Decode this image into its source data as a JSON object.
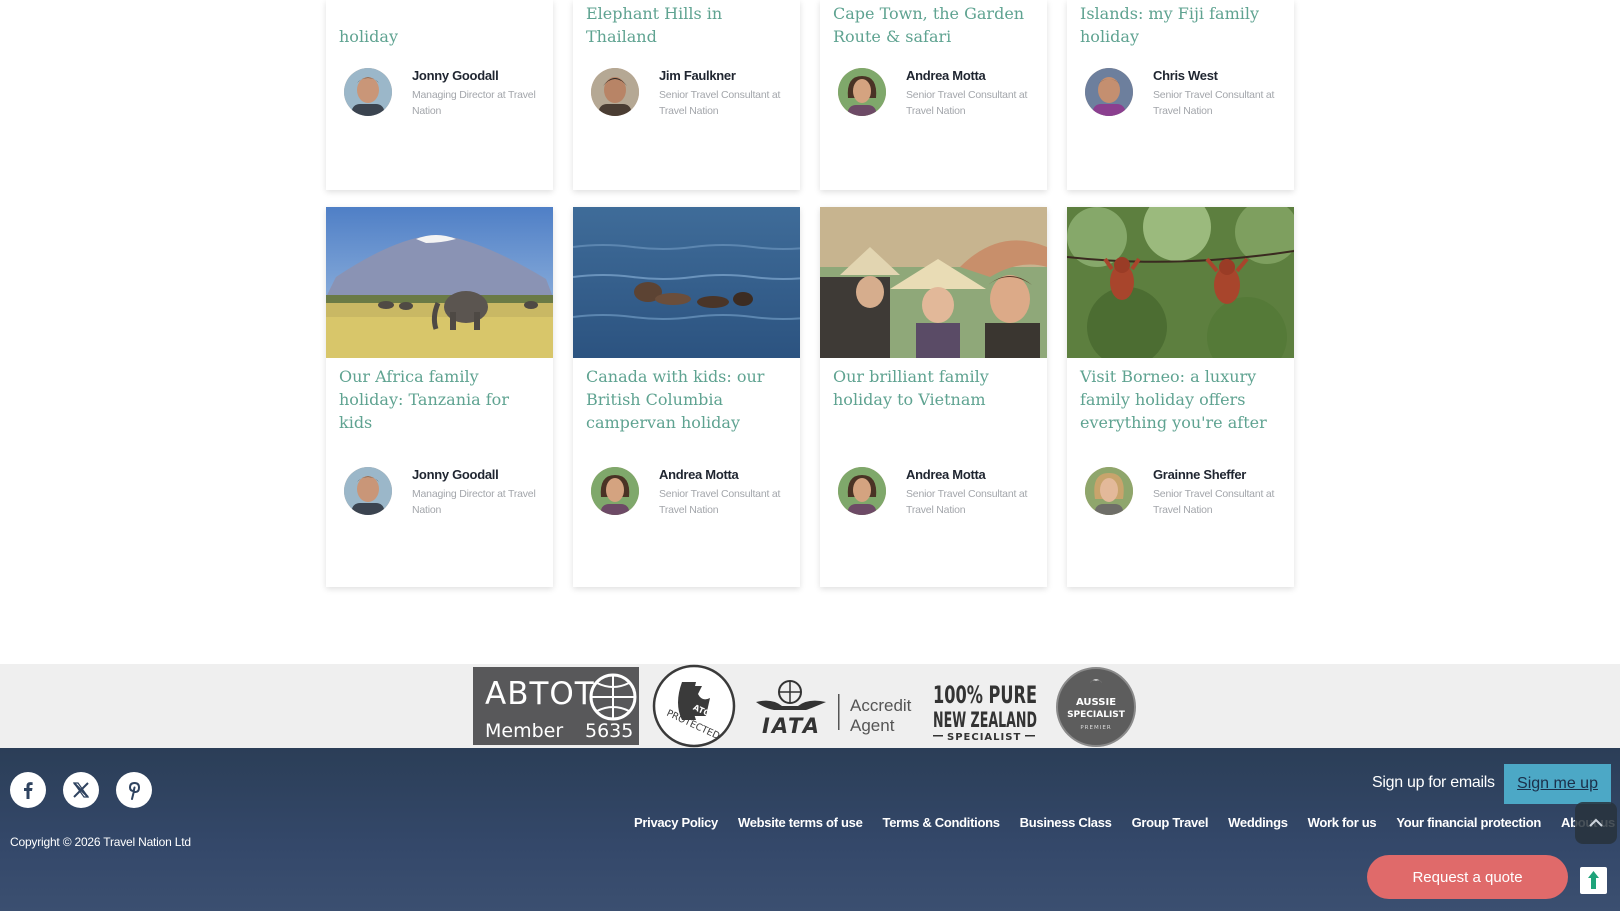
{
  "cards_top": [
    {
      "title": "holiday",
      "author": "Jonny Goodall",
      "role": "Managing Director at Travel Nation"
    },
    {
      "title": "Elephant Hills in Thailand",
      "author": "Jim Faulkner",
      "role": "Senior Travel Consultant at Travel Nation"
    },
    {
      "title": "South Africa with kids: Cape Town, the Garden Route & safari",
      "author": "Andrea Motta",
      "role": "Senior Travel Consultant at Travel Nation"
    },
    {
      "title": "Islands: my Fiji family holiday",
      "author": "Chris West",
      "role": "Senior Travel Consultant at Travel Nation"
    }
  ],
  "cards_bottom": [
    {
      "title": "Our Africa family holiday: Tanzania for kids",
      "author": "Jonny Goodall",
      "role": "Managing Director at Travel Nation",
      "image": "elephant-kilimanjaro"
    },
    {
      "title": "Canada with kids: our British Columbia campervan holiday",
      "author": "Andrea Motta",
      "role": "Senior Travel Consultant at Travel Nation",
      "image": "sea-otters"
    },
    {
      "title": "Our brilliant family holiday to Vietnam",
      "author": "Andrea Motta",
      "role": "Senior Travel Consultant at Travel Nation",
      "image": "family-conical-hats"
    },
    {
      "title": "Visit Borneo: a luxury family holiday offers everything you're after",
      "author": "Grainne Sheffer",
      "role": "Senior Travel Consultant at Travel Nation",
      "image": "orangutans"
    }
  ],
  "badges": {
    "abtot_name": "ABTOT",
    "abtot_member": "Member",
    "abtot_number": "5635",
    "atol_text": "ATOL",
    "atol_protected": "PROTECTED",
    "iata_name": "IATA",
    "iata_accredited": "Accredited",
    "iata_agent": "Agent",
    "nz_line1": "100% PURE",
    "nz_line2": "NEW ZEALAND",
    "nz_line3": "SPECIALIST",
    "aussie_line1": "AUSSIE",
    "aussie_line2": "SPECIALIST",
    "aussie_line3": "PREMIER"
  },
  "footer": {
    "copyright": "Copyright © 2026 Travel Nation Ltd",
    "signup_text": "Sign up for emails",
    "signup_button": "Sign me up",
    "links": [
      "Privacy Policy",
      "Website terms of use",
      "Terms & Conditions",
      "Business Class",
      "Group Travel",
      "Weddings",
      "Work for us",
      "Your financial protection",
      "About us"
    ],
    "request_quote": "Request a quote"
  },
  "colors": {
    "title_green": "#5fa391",
    "footer_navy": "#2f4360",
    "signup_blue": "#4ca8c6",
    "quote_red": "#e06a6a"
  },
  "icons": [
    "facebook-icon",
    "x-twitter-icon",
    "pinterest-icon",
    "chevron-up-icon",
    "feedback-icon"
  ]
}
